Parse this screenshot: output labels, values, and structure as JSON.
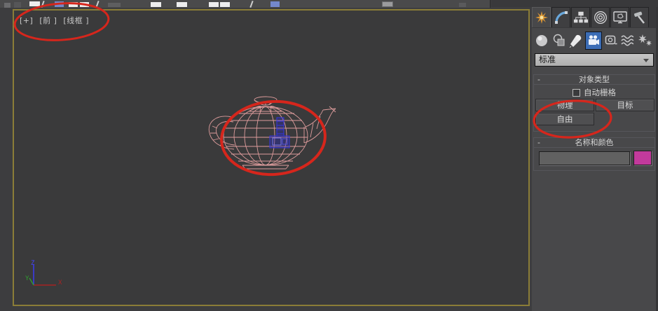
{
  "viewport": {
    "menu_labels": {
      "general": "[+]",
      "view": "[前 ]",
      "shading": "[线框 ]"
    },
    "axis_labels": {
      "x": "X",
      "y": "Y",
      "z": "Z"
    },
    "wireframe_color": "#e7a2a2",
    "border_color": "#8b7d37"
  },
  "command_panel": {
    "tabs": [
      {
        "icon": "create-star-icon",
        "active": true
      },
      {
        "icon": "modify-curve-icon",
        "active": false
      },
      {
        "icon": "hierarchy-tree-icon",
        "active": false
      },
      {
        "icon": "motion-circles-icon",
        "active": false
      },
      {
        "icon": "display-monitor-icon",
        "active": false
      },
      {
        "icon": "utilities-hammer-icon",
        "active": false
      }
    ],
    "categories": [
      {
        "icon": "geometry-sphere-icon",
        "selected": false
      },
      {
        "icon": "shapes-icon",
        "selected": false
      },
      {
        "icon": "lights-spotlight-icon",
        "selected": false
      },
      {
        "icon": "cameras-icon",
        "selected": true
      },
      {
        "icon": "helpers-tape-icon",
        "selected": false
      },
      {
        "icon": "spacewarps-waves-icon",
        "selected": false
      },
      {
        "icon": "systems-icon",
        "selected": false
      }
    ],
    "type_dropdown": {
      "value": "标准"
    },
    "rollouts": {
      "object_type": {
        "collapse_symbol": "-",
        "title": "对象类型",
        "autogrid": {
          "label": "自动栅格",
          "checked": false
        },
        "buttons": [
          "物理",
          "目标",
          "自由"
        ]
      },
      "name_and_color": {
        "collapse_symbol": "-",
        "title": "名称和颜色",
        "name_value": "",
        "swatch_color": "#c23a9c"
      }
    }
  },
  "annotations": {
    "highlight_color": "#d6261c",
    "camera_color": "#3535e0"
  }
}
